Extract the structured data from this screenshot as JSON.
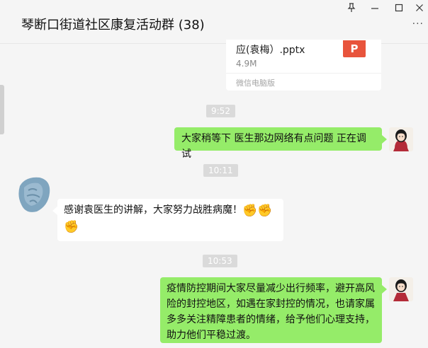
{
  "window": {
    "title": "琴断口街道社区康复活动群 (38)",
    "pin_icon": "pin-icon",
    "minimize_icon": "minimize-icon",
    "maximize_icon": "maximize-icon",
    "close_icon": "close-icon",
    "more_icon": "more-icon"
  },
  "file_card": {
    "name": "应(袁梅）.pptx",
    "size": "4.9M",
    "icon_letter": "P",
    "source": "微信电脑版"
  },
  "messages": [
    {
      "type": "time",
      "text": "9:52"
    },
    {
      "type": "sent",
      "text": "大家稍等下 医生那边网络有点问题 正在调试"
    },
    {
      "type": "time",
      "text": "10:11"
    },
    {
      "type": "received",
      "text": "感谢袁医生的讲解，大家努力战胜病魔！",
      "emoji": "✊"
    },
    {
      "type": "time",
      "text": "10:53"
    },
    {
      "type": "sent",
      "lines": [
        "疫情防控期间大家尽量减少出行频率，避开高风",
        "险的封控地区，如遇在家封控的情况，也请家属",
        "多多关注精障患者的情绪，给予他们心理支持，",
        "助力他们平稳过渡。"
      ]
    }
  ],
  "colors": {
    "sent_bubble": "#95ec69",
    "received_bubble": "#ffffff",
    "background": "#f5f5f5",
    "file_icon": "#e8543c"
  }
}
